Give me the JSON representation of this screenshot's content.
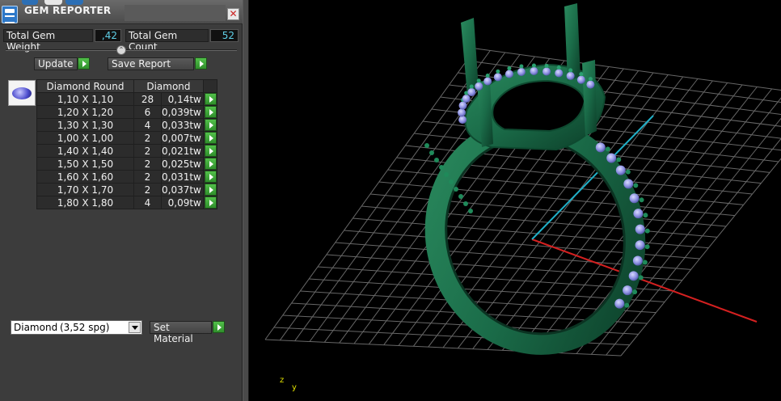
{
  "panel": {
    "title": "GEM REPORTER",
    "close_glyph": "✕",
    "total_weight_label": "Total Gem Weight",
    "total_weight_value": ",42",
    "total_count_label": "Total Gem Count",
    "total_count_value": "52",
    "update_label": "Update",
    "save_report_label": "Save Report",
    "collapse_glyph": "⌃",
    "table": {
      "headers": [
        "Diamond Round",
        "Diamond"
      ],
      "rows": [
        {
          "size": "1,10 X 1,10",
          "count": "28",
          "weight": "0,14tw"
        },
        {
          "size": "1,20 X 1,20",
          "count": "6",
          "weight": "0,039tw"
        },
        {
          "size": "1,30 X 1,30",
          "count": "4",
          "weight": "0,033tw"
        },
        {
          "size": "1,00 X 1,00",
          "count": "2",
          "weight": "0,007tw"
        },
        {
          "size": "1,40 X 1,40",
          "count": "2",
          "weight": "0,021tw"
        },
        {
          "size": "1,50 X 1,50",
          "count": "2",
          "weight": "0,025tw"
        },
        {
          "size": "1,60 X 1,60",
          "count": "2",
          "weight": "0,031tw"
        },
        {
          "size": "1,70 X 1,70",
          "count": "2",
          "weight": "0,037tw"
        },
        {
          "size": "1,80 X 1,80",
          "count": "4",
          "weight": "0,09tw"
        }
      ]
    },
    "material": {
      "name": "Diamond",
      "spg": "(3,52 spg)"
    },
    "set_material_label": "Set Material"
  },
  "viewport": {
    "axis_z": "z",
    "axis_y": "y",
    "colors": {
      "metal": "#1a6b48",
      "gems": "#8a8ee0",
      "grid": "#8a8a8a",
      "axis_x": "#d42020",
      "axis_y": "#20b0c8"
    }
  }
}
